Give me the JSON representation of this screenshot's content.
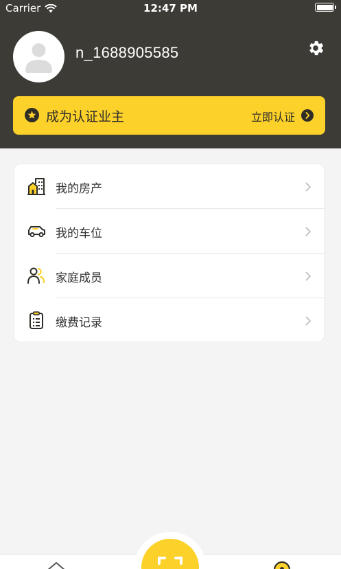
{
  "status_bar": {
    "carrier": "Carrier",
    "time": "12:47 PM"
  },
  "profile": {
    "username": "n_1688905585"
  },
  "verify_banner": {
    "title": "成为认证业主",
    "action": "立即认证"
  },
  "menu": {
    "items": [
      {
        "label": "我的房产",
        "icon": "building-icon"
      },
      {
        "label": "我的车位",
        "icon": "car-icon"
      },
      {
        "label": "家庭成员",
        "icon": "family-icon"
      },
      {
        "label": "缴费记录",
        "icon": "clipboard-icon"
      }
    ]
  },
  "colors": {
    "header_bg": "#3d3b35",
    "accent": "#fcd12a",
    "page_bg": "#f4f4f4"
  }
}
